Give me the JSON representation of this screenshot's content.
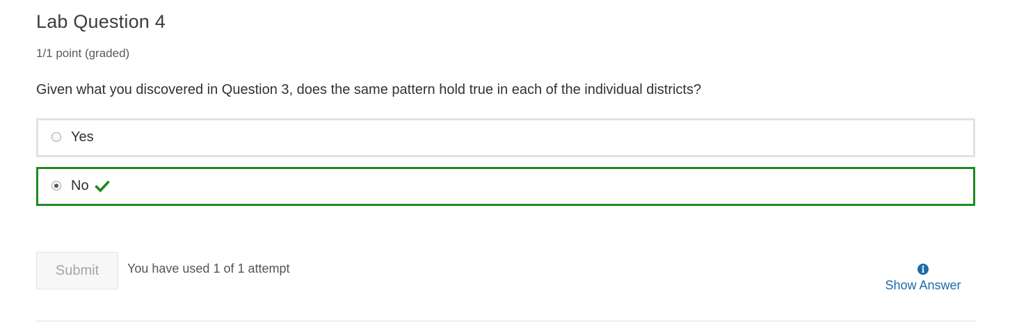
{
  "problem": {
    "title": "Lab Question 4",
    "points": "1/1 point (graded)",
    "question": "Given what you discovered in Question 3, does the same pattern hold true in each of the individual districts?"
  },
  "choices": [
    {
      "label": "Yes",
      "selected": false
    },
    {
      "label": "No",
      "selected": true,
      "status": "correct"
    }
  ],
  "actions": {
    "submit_label": "Submit",
    "attempts_text": "You have used 1 of 1 attempt",
    "show_answer_label": "Show Answer"
  },
  "colors": {
    "correct": "#1f8a1f",
    "link": "#1d6aa8",
    "unselected_border": "#e2e2e2"
  },
  "icons": {
    "correct": "checkmark-icon",
    "show_answer": "info-circle-icon"
  }
}
